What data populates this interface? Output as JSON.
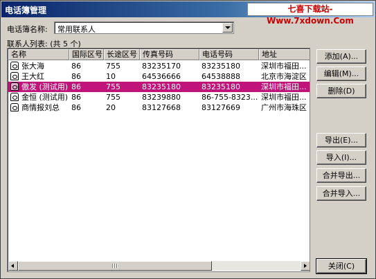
{
  "window": {
    "title": "电话簿管理"
  },
  "watermark": "七喜下载站-Www.7xdown.Com",
  "phonebook": {
    "label": "电话簿名称:",
    "selected": "常用联系人"
  },
  "contacts": {
    "list_label": "联系人列表: (共 5 个)",
    "columns": [
      "名称",
      "国际区号",
      "长途区号",
      "传真号码",
      "电话号码",
      "地址"
    ],
    "rows": [
      {
        "name": "张大海",
        "intl": "86",
        "area": "755",
        "fax": "83235170",
        "phone": "83235180",
        "address": "深圳市福田..."
      },
      {
        "name": "王大红",
        "intl": "86",
        "area": "10",
        "fax": "64536666",
        "phone": "64538888",
        "address": "北京市海淀区"
      },
      {
        "name": "傲发 (测试用)",
        "intl": "86",
        "area": "755",
        "fax": "83235180",
        "phone": "83235180",
        "address": "深圳市福田..."
      },
      {
        "name": "金恒 (测试用)",
        "intl": "86",
        "area": "755",
        "fax": "83239880",
        "phone": "86-755-8323...",
        "address": "深圳市福田..."
      },
      {
        "name": "商情报刘总",
        "intl": "86",
        "area": "20",
        "fax": "83127668",
        "phone": "83127669",
        "address": "广州市海珠区"
      }
    ],
    "selected_row": 2
  },
  "buttons": {
    "add": "添加(A)...",
    "edit": "编辑(M)...",
    "delete": "删除(D)",
    "export": "导出(E)...",
    "import": "导入(I)...",
    "merge_export": "合并导出...",
    "merge_import": "合并导入...",
    "close": "关闭(C)"
  },
  "colors": {
    "title_bar": "#0a246a",
    "selection": "#c0147a",
    "watermark_text": "#cc0000",
    "face": "#d4d0c8"
  }
}
